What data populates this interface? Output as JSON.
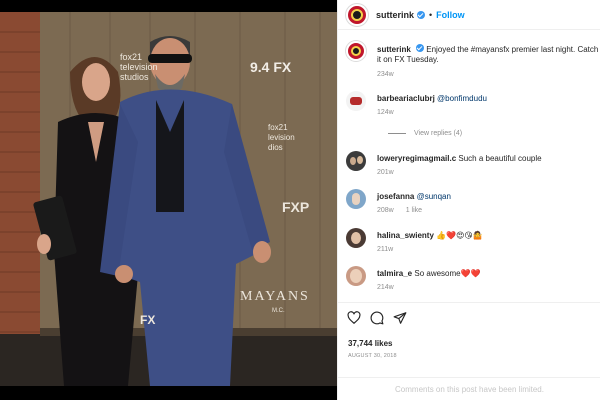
{
  "post": {
    "username": "sutterink",
    "separator": "•",
    "follow_label": "Follow",
    "caption_text": "Enjoyed the #mayansfx premier last night. Catch it on FX Tuesday.",
    "caption_time": "234w",
    "likes": "37,744 likes",
    "date": "AUGUST 30, 2018",
    "comments_limited": "Comments on this post have been limited."
  },
  "photo": {
    "backdrop_text_network": "9.4 FX",
    "backdrop_text_studio_1": "fox21",
    "backdrop_text_studio_2": "television",
    "backdrop_text_studio_3": "studios",
    "backdrop_text_studio_4": "fox21",
    "backdrop_text_studio_5": "levision",
    "backdrop_text_studio_6": "dios",
    "backdrop_text_show": "MAYANS",
    "backdrop_text_show_sub": "M.C.",
    "backdrop_text_fx2": "FX",
    "backdrop_text_fxp": "FXP"
  },
  "comments": [
    {
      "user": "barbeariaclubrj",
      "text": "",
      "mention": "@bonfimdudu",
      "time": "124w",
      "likes": "",
      "reply": "",
      "view_replies": "View replies (4)"
    },
    {
      "user": "loweryregimagmail.c",
      "text": "Such a beautiful couple",
      "mention": "",
      "time": "201w",
      "likes": "",
      "reply": "",
      "view_replies": ""
    },
    {
      "user": "josefanna",
      "text": "",
      "mention": "@sunqan",
      "time": "208w",
      "likes": "1 like",
      "reply": "",
      "view_replies": ""
    },
    {
      "user": "halina_swienty",
      "text": "👍❤️😍😘🤷",
      "mention": "",
      "time": "211w",
      "likes": "",
      "reply": "",
      "view_replies": ""
    },
    {
      "user": "talmira_e",
      "text": "So awesome❤️❤️",
      "mention": "",
      "time": "214w",
      "likes": "",
      "reply": "",
      "view_replies": ""
    }
  ],
  "icons": {
    "like": "heart-icon",
    "comment": "comment-icon",
    "share": "share-icon",
    "verified": "verified-badge-icon"
  },
  "colors": {
    "follow_blue": "#0095f6",
    "verified_blue": "#3897f0",
    "mention_blue": "#00376b",
    "muted": "#8e8e8e",
    "avatar_red": "#c0162b"
  }
}
